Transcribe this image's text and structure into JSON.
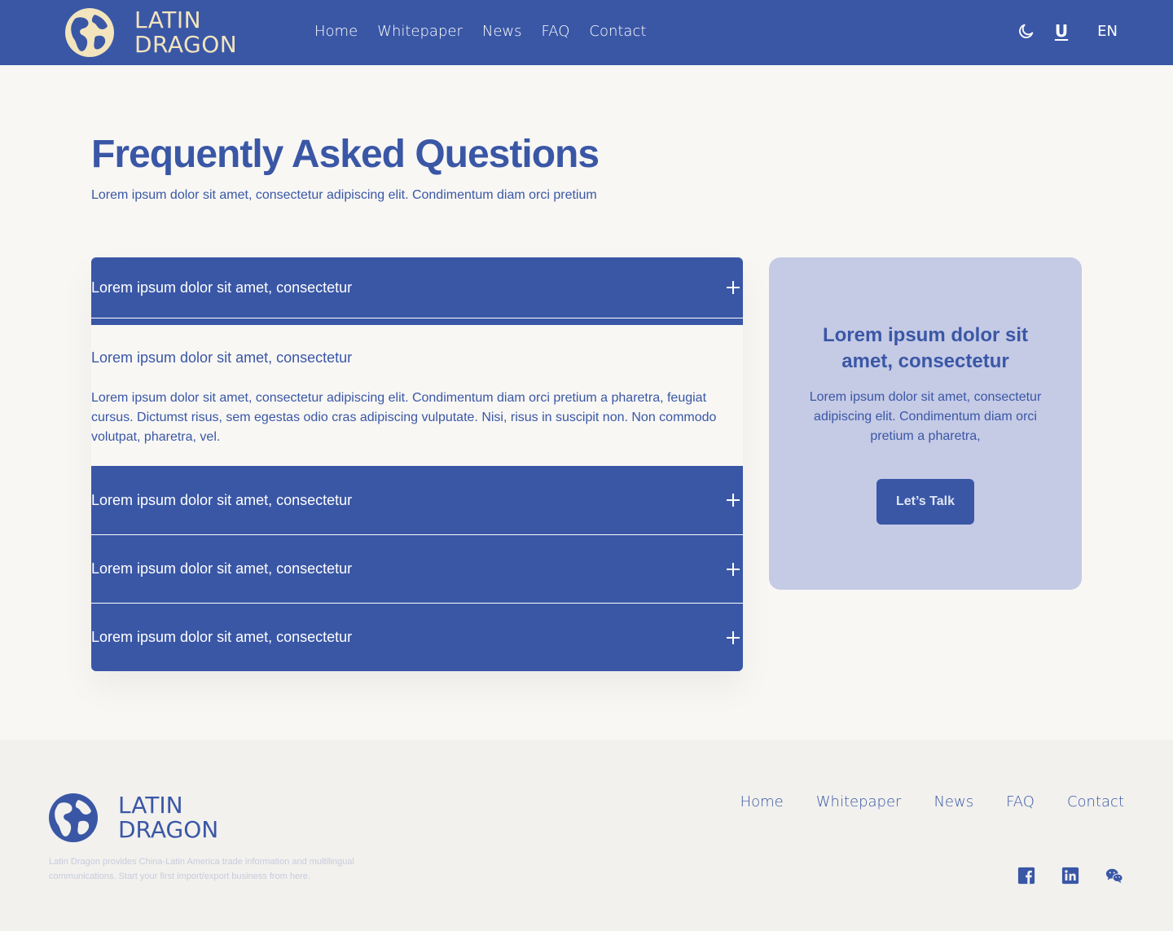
{
  "brand": {
    "line1": "LATIN",
    "line2": "DRAGON"
  },
  "nav": [
    "Home",
    "Whitepaper",
    "News",
    "FAQ",
    "Contact"
  ],
  "header": {
    "u_label": "U",
    "lang": "EN"
  },
  "hero": {
    "title": "Frequently Asked Questions",
    "subtitle": "Lorem ipsum dolor sit amet, consectetur adipiscing elit. Condimentum diam orci pretium"
  },
  "faq": {
    "items": [
      {
        "question": "Lorem ipsum dolor sit amet, consectetur",
        "expanded": false
      },
      {
        "question": "Lorem ipsum dolor sit amet, consectetur",
        "expanded": true,
        "answer": "Lorem ipsum dolor sit amet, consectetur adipiscing elit. Condimentum diam orci pretium a pharetra, feugiat cursus. Dictumst risus, sem egestas odio cras adipiscing vulputate. Nisi, risus in suscipit non. Non commodo volutpat, pharetra, vel."
      },
      {
        "question": "Lorem ipsum dolor sit amet, consectetur",
        "expanded": false
      },
      {
        "question": "Lorem ipsum dolor sit amet, consectetur",
        "expanded": false
      },
      {
        "question": "Lorem ipsum dolor sit amet, consectetur",
        "expanded": false
      }
    ]
  },
  "card": {
    "title": "Lorem ipsum dolor sit amet, consectetur",
    "text": "Lorem ipsum dolor sit amet, consectetur adipiscing elit. Condimentum diam orci pretium a pharetra,",
    "button": "Let’s Talk"
  },
  "footer": {
    "description": "Latin Dragon provides China-Latin America trade information and multilingual communications. Start your first import/export business from here.",
    "nav": [
      "Home",
      "Whitepaper",
      "News",
      "FAQ",
      "Contact"
    ],
    "social": [
      "facebook-icon",
      "linkedin-icon",
      "wechat-icon"
    ]
  },
  "colors": {
    "primary": "#3a57a6",
    "accent": "#f2e4bd",
    "card": "#c5cae5",
    "background": "#f8f7f4"
  }
}
